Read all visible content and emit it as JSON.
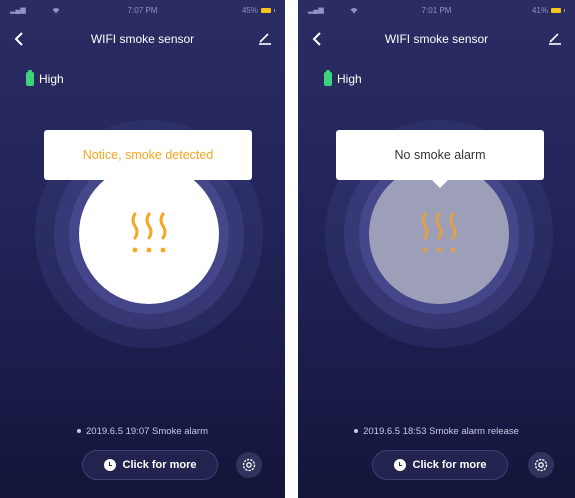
{
  "screens": [
    {
      "status": {
        "time": "7:07 PM",
        "battery": "45%"
      },
      "nav": {
        "title": "WIFI smoke sensor"
      },
      "battery_level": "High",
      "notice": "Notice, smoke detected",
      "event": "2019.6.5 19:07 Smoke alarm",
      "more_button": "Click for more",
      "icons": [
        "back-icon",
        "edit-icon",
        "battery-icon",
        "smoke-icon",
        "clock-icon",
        "settings-icon"
      ]
    },
    {
      "status": {
        "time": "7:01 PM",
        "battery": "41%"
      },
      "nav": {
        "title": "WIFI smoke sensor"
      },
      "battery_level": "High",
      "notice": "No smoke alarm",
      "event": "2019.6.5 18:53 Smoke alarm release",
      "more_button": "Click for more",
      "icons": [
        "back-icon",
        "edit-icon",
        "battery-icon",
        "smoke-icon",
        "clock-icon",
        "settings-icon"
      ]
    }
  ],
  "colors": {
    "background_top": "#2b2c63",
    "background_bottom": "#141539",
    "alert_text": "#f5a623",
    "smoke_icon": "#f5a623",
    "battery": "#3bd47a",
    "status_battery": "#f5c518"
  }
}
